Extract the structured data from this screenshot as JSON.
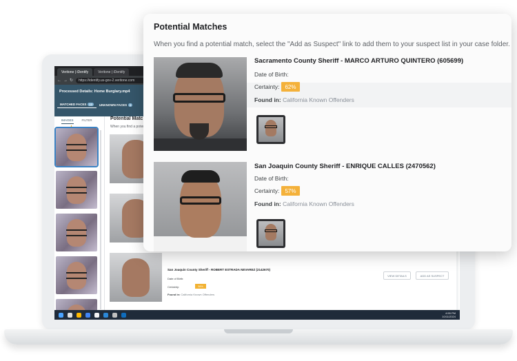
{
  "browser": {
    "tabs": [
      "Veritone | iDentify",
      "Veritone | iDentify"
    ],
    "url": "https://identify.us-gov-2.veritone.com"
  },
  "app": {
    "processed_details": "Processed Details: Home Burglary.mp4",
    "subtabs": [
      {
        "label": "MATCHED FACES",
        "count": "13"
      },
      {
        "label": "UNKNOWN FACES",
        "count": "0"
      }
    ],
    "left_tabs": [
      "IMAGES",
      "FILTER"
    ]
  },
  "background_page": {
    "title": "Potential Matches",
    "instruction": "When you find a potential match, select the \"Add as Suspect\" link to add them to your suspect list in your case folder.",
    "third_match": {
      "name": "San Joaquin County Sheriff - ROBERT ESTRADA NEVAREZ (2142670)",
      "dob_label": "Date of Birth:",
      "certainty_label": "Certainty:",
      "certainty": "54%",
      "found_label": "Found in:",
      "found_value": "California Known Offenders",
      "view_details": "VIEW DETAILS",
      "add_suspect": "ADD AS SUSPECT"
    }
  },
  "taskbar": {
    "time": "4:55 PM",
    "date": "10/11/2024"
  },
  "overlay": {
    "title": "Potential Matches",
    "instruction": "When you find a potential match, select the \"Add as Suspect\" link to add them to your suspect list in your case folder.",
    "matches": [
      {
        "name": "Sacramento County Sheriff - MARCO ARTURO QUINTERO (605699)",
        "dob_label": "Date of Birth:",
        "certainty_label": "Certainty:",
        "certainty": "62%",
        "found_label": "Found in:",
        "found_value": "California Known Offenders"
      },
      {
        "name": "San Joaquin County Sheriff - ENRIQUE CALLES (2470562)",
        "dob_label": "Date of Birth:",
        "certainty_label": "Certainty:",
        "certainty": "57%",
        "found_label": "Found in:",
        "found_value": "California Known Offenders"
      }
    ]
  },
  "colors": {
    "header": "#35566a",
    "certainty_pill": "#f4b13a",
    "taskbar": "#1f2b3a"
  }
}
